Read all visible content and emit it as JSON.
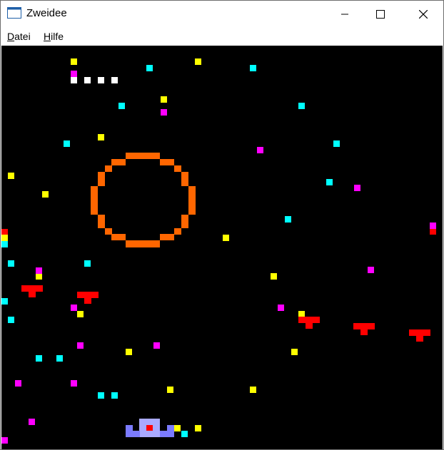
{
  "window": {
    "title": "Zweidee",
    "controls": {
      "minimize_icon": "minimize-icon",
      "maximize_icon": "maximize-icon",
      "close_icon": "close-icon"
    }
  },
  "menu": {
    "items": [
      {
        "label": "Datei"
      },
      {
        "label": "Hilfe"
      }
    ]
  },
  "game": {
    "background": "#000000",
    "colors": {
      "yellow": "#ffff00",
      "cyan": "#00ffff",
      "magenta": "#ff00ff",
      "white": "#ffffff",
      "orange": "#ff6600",
      "red": "#ff0000",
      "ship": "#7b7bff",
      "ship_core": "#aaaaff"
    }
  }
}
